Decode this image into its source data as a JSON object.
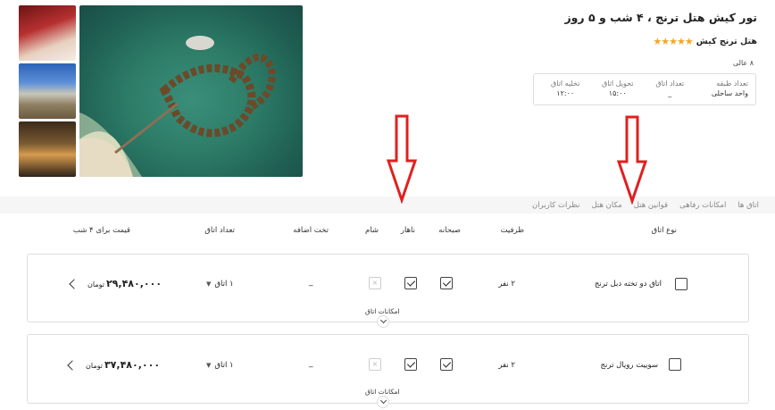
{
  "tour": {
    "title": "تور کیش هتل ترنج ، ۴ شب و ۵ روز",
    "hotel_name": "هتل ترنج کیش",
    "stars": "★★★★★",
    "rating": "۸ عالی"
  },
  "info": [
    {
      "label": "تعداد طبقه",
      "value": "واحد ساحلی"
    },
    {
      "label": "تعداد اتاق",
      "value": "_"
    },
    {
      "label": "تحویل اتاق",
      "value": "۱۵:۰۰"
    },
    {
      "label": "تخلیه اتاق",
      "value": "۱۲:۰۰"
    }
  ],
  "tabs": [
    "اتاق ها",
    "امکانات رفاهی",
    "قوانین هتل",
    "مکان هتل",
    "نظرات کاربران"
  ],
  "table_headers": {
    "room_type": "نوع اتاق",
    "capacity": "ظرفیت",
    "breakfast": "صبحانه",
    "lunch": "ناهار",
    "dinner": "شام",
    "extra_bed": "تخت اضافه",
    "room_count": "تعداد اتاق",
    "price": "قیمت برای ۴ شب"
  },
  "rooms": [
    {
      "name": "اتاق دو تخته دبل ترنج",
      "capacity": "۲ نفر",
      "breakfast": true,
      "lunch": true,
      "dinner": false,
      "extra_bed": "_",
      "room_count": "۱ اتاق",
      "price": "۲۹,۴۸۰,۰۰۰",
      "currency": "تومان",
      "amenities_label": "امکانات اتاق"
    },
    {
      "name": "سوییت رویال ترنج",
      "capacity": "۲ نفر",
      "breakfast": true,
      "lunch": true,
      "dinner": false,
      "extra_bed": "_",
      "room_count": "۱ اتاق",
      "price": "۳۷,۴۸۰,۰۰۰",
      "currency": "تومان",
      "amenities_label": "امکانات اتاق"
    }
  ],
  "colors": {
    "star": "#f5a623",
    "annotation_arrow": "#e02020"
  }
}
